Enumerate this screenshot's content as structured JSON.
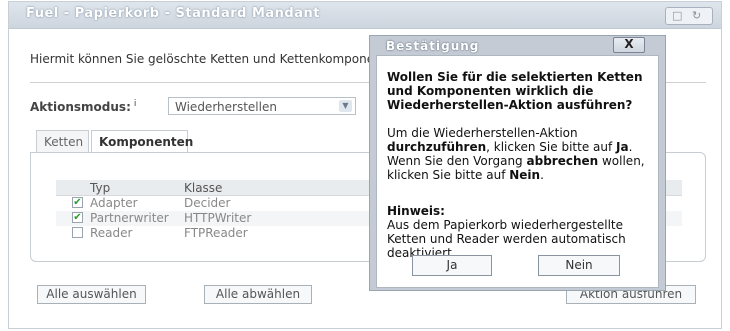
{
  "window": {
    "title": "Fuel - Papierkorb - Standard Mandant"
  },
  "main": {
    "description": "Hiermit können Sie gelöschte Ketten und Kettenkomponent",
    "mode_label": "Aktionsmodus:",
    "mode_info": "i",
    "mode_select_value": "Wiederherstellen",
    "tabs": [
      {
        "label": "Ketten",
        "active": false
      },
      {
        "label": "Komponenten",
        "active": true
      }
    ],
    "table": {
      "columns": [
        "Typ",
        "Klasse"
      ],
      "rows": [
        {
          "typ": "Adapter",
          "klasse": "Decider",
          "checked": true
        },
        {
          "typ": "Partnerwriter",
          "klasse": "HTTPWriter",
          "checked": true
        },
        {
          "typ": "Reader",
          "klasse": "FTPReader",
          "checked": false
        }
      ]
    },
    "buttons": {
      "select_all": "Alle auswählen",
      "deselect_all": "Alle abwählen",
      "execute": "Aktion ausführen"
    }
  },
  "dialog": {
    "title": "Bestätigung",
    "close_label": "X",
    "question": "Wollen Sie für die selektierten Ketten und Komponenten wirklich die Wiederherstellen-Aktion ausführen?",
    "instruction": {
      "t1": "Um die Wiederherstellen-Aktion ",
      "b1": "durchzuführen",
      "t2": ", klicken Sie bitte auf ",
      "b2": "Ja",
      "t3": ". Wenn Sie den Vorgang ",
      "b3": "abbrechen",
      "t4": " wollen, klicken Sie bitte auf ",
      "b4": "Nein",
      "t5": "."
    },
    "hint_title": "Hinweis:",
    "hint_text": "Aus dem Papierkorb wiederhergestellte Ketten und Reader werden automatisch deaktiviert.",
    "yes": "Ja",
    "no": "Nein"
  },
  "colors": {
    "checkmark": "#2a9a2a",
    "dialog_frame": "#c4cbd4"
  }
}
